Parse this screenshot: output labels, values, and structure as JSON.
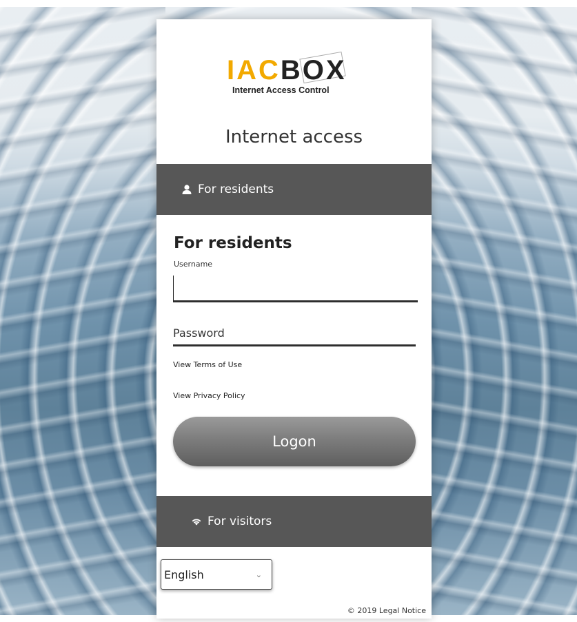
{
  "logo": {
    "word_part1": "IAC",
    "word_part2": "BOX",
    "subtitle": "Internet Access Control",
    "accent_color": "#f2a900"
  },
  "page_title": "Internet access",
  "residents_tab": {
    "label": "For residents",
    "icon": "user-icon"
  },
  "form": {
    "heading": "For residents",
    "username_label": "Username",
    "username_value": "",
    "password_placeholder": "Password",
    "terms_link": "View Terms of Use",
    "privacy_link": "View Privacy Policy",
    "logon_label": "Logon"
  },
  "visitors_tab": {
    "label": "For visitors",
    "icon": "wifi-icon"
  },
  "language": {
    "selected": "English"
  },
  "footer": {
    "copyright": "© 2019",
    "legal_link": "Legal Notice"
  }
}
